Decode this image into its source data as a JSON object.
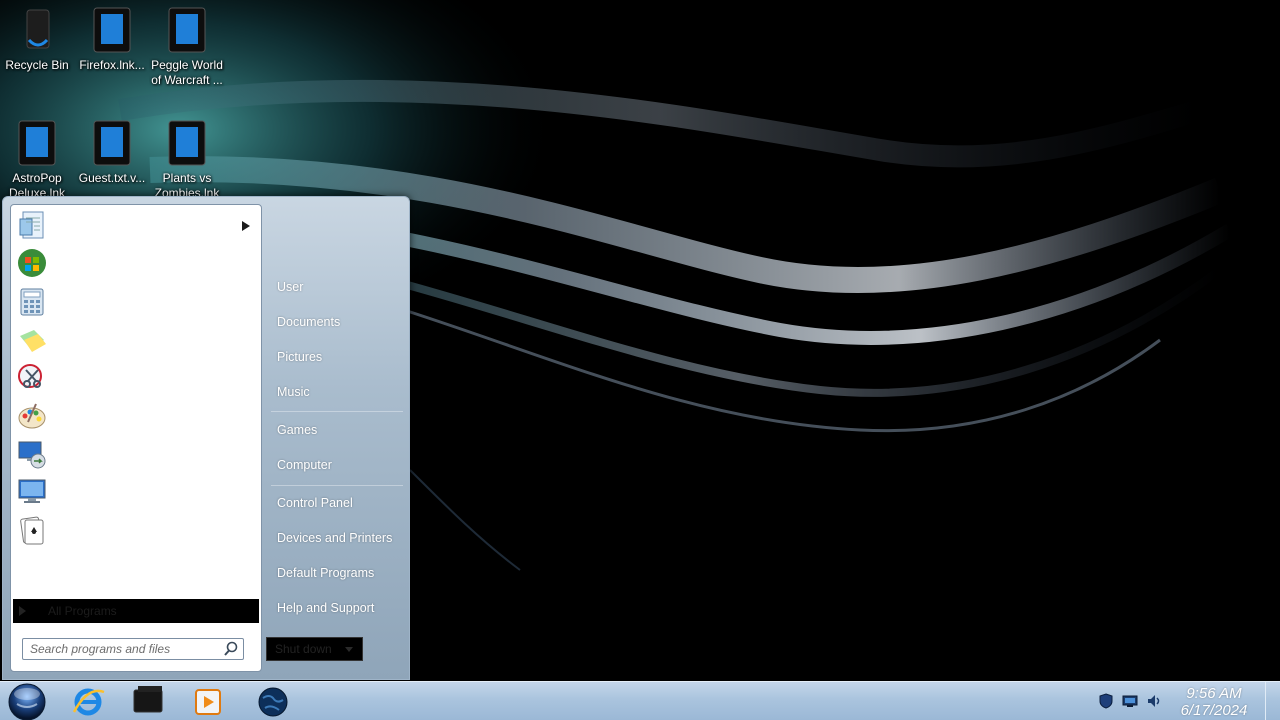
{
  "desktop": {
    "icons": [
      {
        "label": "Recycle Bin",
        "icon": "recycle-bin-icon"
      },
      {
        "label": "Firefox.lnk...",
        "icon": "shortcut-file-icon"
      },
      {
        "label": "Peggle World of Warcraft ...",
        "icon": "shortcut-file-icon"
      },
      {
        "label": "AstroPop Deluxe.lnk",
        "icon": "shortcut-file-icon"
      },
      {
        "label": "Guest.txt.v...",
        "icon": "shortcut-file-icon"
      },
      {
        "label": "Plants vs Zombies.lnk",
        "icon": "shortcut-file-icon"
      }
    ]
  },
  "start_menu": {
    "pinned": [
      {
        "icon": "notepad-icon",
        "has_submenu": true
      },
      {
        "icon": "getting-started-icon"
      },
      {
        "icon": "calculator-icon"
      },
      {
        "icon": "sticky-notes-icon"
      },
      {
        "icon": "snipping-tool-icon"
      },
      {
        "icon": "paint-icon"
      },
      {
        "icon": "remote-desktop-icon"
      },
      {
        "icon": "windows-display-icon"
      },
      {
        "icon": "solitaire-icon"
      }
    ],
    "all_programs": "All Programs",
    "search_placeholder": "Search programs and files",
    "right_links": [
      "User",
      "Documents",
      "Pictures",
      "Music",
      "Games",
      "Computer",
      "Control Panel",
      "Devices and Printers",
      "Default Programs",
      "Help and Support"
    ],
    "shutdown_label": "Shut down"
  },
  "taskbar": {
    "apps": [
      "internet-explorer-icon",
      "media-center-icon",
      "media-player-icon",
      "globe-icon"
    ],
    "tray": [
      "action-center-icon",
      "network-icon",
      "volume-icon"
    ],
    "time": "9:56 AM",
    "date": "6/17/2024"
  }
}
